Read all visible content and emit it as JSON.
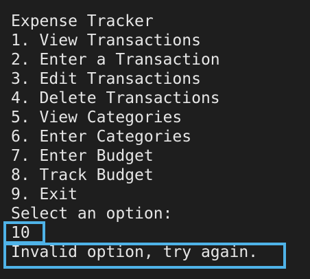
{
  "terminal": {
    "title": "Expense Tracker",
    "menu": [
      "1. View Transactions",
      "2. Enter a Transaction",
      "3. Edit Transactions",
      "4. Delete Transactions",
      "5. View Categories",
      "6. Enter Categories",
      "7. Enter Budget",
      "8. Track Budget",
      "9. Exit"
    ],
    "prompt": "Select an option:",
    "user_input": "10",
    "error_message": "Invalid option, try again."
  },
  "colors": {
    "background": "#1e1e1e",
    "text": "#e6e6e6",
    "highlight": "#4fb3e8"
  }
}
